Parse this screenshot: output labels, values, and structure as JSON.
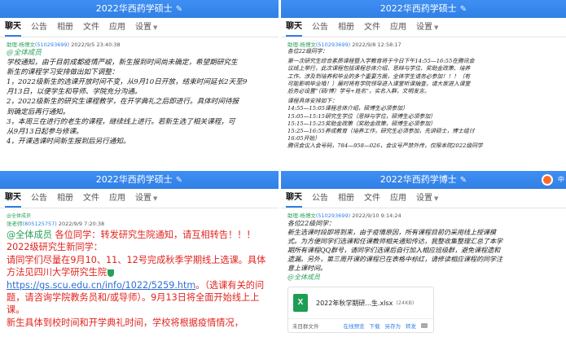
{
  "colors": {
    "titlebar": "#2f7fe6",
    "author": "#2aa05a",
    "qq": "#2f7fe6",
    "red_text": "#e0231e",
    "xlsx": "#1f9d55"
  },
  "tabs": {
    "chat": "聊天",
    "notice": "公告",
    "album": "相册",
    "files": "文件",
    "apps": "应用",
    "settings": "设置"
  },
  "panel_tl": {
    "title": "2022华西药学硕士",
    "meta": {
      "author": "助理-杨博文",
      "qq": "(510293699)",
      "time": "2022/9/5 23:40:38"
    },
    "lines": [
      "@全体成员",
      "学校通知，由于目前成都疫情严峻，新生报到时间尚未确定，希望期研究生",
      "新生的课程学习安排做出如下调整：",
      "1，2022级新生的选课开放时间不变，从9月10日开放，结束时间延长2天至9",
      "月13日，以便学生和导师、学院充分沟通。",
      "2，2022级新生的研究生课程教学，在开学典礼之后即进行。具体时间待报",
      "到确定后再行通知。",
      "3，本周三在进行的老生的课程，继续线上进行。若新生选了相关课程，可",
      "从9月13日起参与修课。",
      "4，开课选课时间新生报到后另行通知。"
    ]
  },
  "panel_tr": {
    "title": "2022华西药学硕士",
    "meta": {
      "author": "助理-杨博文",
      "qq": "(510293699)",
      "time": "2022/9/8 12:58:17"
    },
    "lines": [
      "各位22级同学：",
      "第一次研究生综合素质课程暨入学教育将于今日下午14:55—16:55在腾讯会",
      "议线上举行，此次课程包括课程总体介绍、思辩与学位、奖助金政策、培养",
      "工作、涉及到培养和毕业的多个重要方面，全体学生请务必参加！！！（有",
      "可能影响毕业哦！）届时将有学院领导进入课堂听课抽查，请大家进入课堂",
      "后务必设置“（硕/博）学号+姓名”，实名入群，文明发言。",
      "课程具体安排如下：",
      "14:55—15:05课程总体介绍，硕博生必须参加）",
      "15:05—15:15研究生学位（思辩与学位，硕博生必须参加）",
      "15:15—15:25奖助金政策（奖助金政策，硕博生必须参加）",
      "15:25—16:55养成教育（培养工作，研究生必须参加，先讲硕士，博士组讨",
      "16:05开始）",
      "腾讯会议入会号码，784—958—026，会议号严禁外传，仅限本院2022级同学"
    ]
  },
  "panel_bl": {
    "title": "2022华西药学硕士",
    "meta_small_mention": "@全体成员",
    "meta": {
      "author": "张老师",
      "qq": "(805125757)",
      "time": "2022/9/9 7:20:38"
    },
    "message": {
      "mention": "@全体成员",
      "text1": " 各位同学：转发研究生院通知，请互相转告！！！",
      "text2": "2022级研究生新同学：",
      "text3": "请同学们尽量在9月10、11、12号完成秋季学期线上选课。具体方法见四川大学研究生院",
      "link": "https://gs.scu.edu.cn/info/1022/5259.htm",
      "text4": "。（选课有关的问题，请咨询学院教务员和/或导师）。9月13日将全面开始线上上课。",
      "text5": "新生具体到校时间和开学典礼时间，学校将根据疫情情况，"
    }
  },
  "panel_br": {
    "title": "2022华西药学博士",
    "badge": "中",
    "meta": {
      "author": "助理-杨博文",
      "qq": "(510293699)",
      "time": "2022/9/10 9:14:24"
    },
    "lines": [
      "各位22级同学：",
      "新生选课时段即将到来，由于疫情原因，所有课程目前仍采用线上授课模",
      "式。为方便同学们选课和任课教师相关通知传达，我整收集整理汇总了本学",
      "期所有课程QQ群号，请同学们选课后自行加入相应班级群，避免课程遗和",
      "遗漏。另外，第三周开课的课程已在表格中标红，请修读相应课程的同学注",
      "意上课时间。",
      "@全体成员"
    ],
    "file": {
      "name": "2022年秋学期研...生.xlsx",
      "size": "(24KB)",
      "status": "未目群文件",
      "actions": [
        "在线预览",
        "下载",
        "另存为",
        "转发"
      ]
    }
  }
}
